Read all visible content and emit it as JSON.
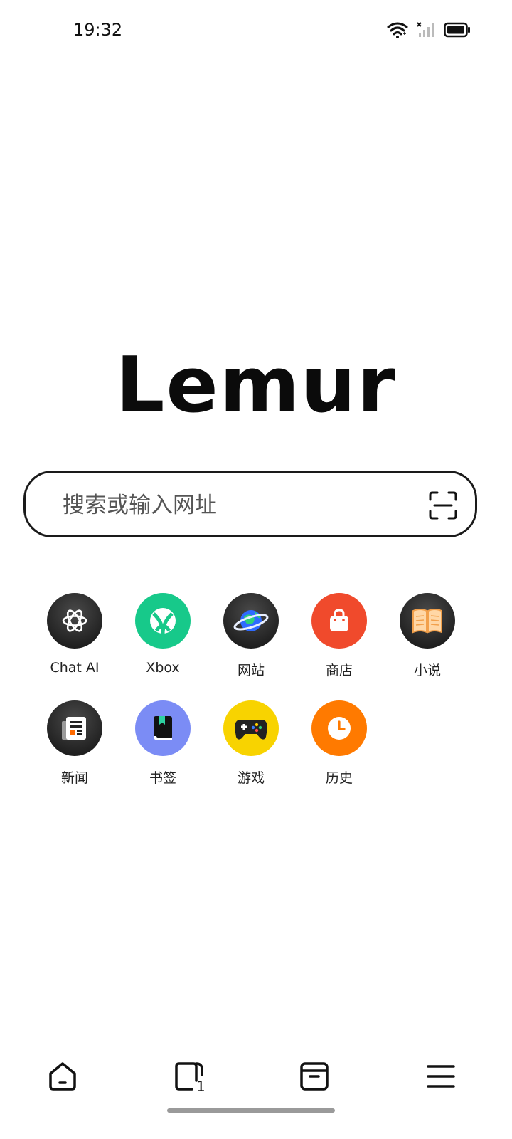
{
  "status_bar": {
    "time": "19:32",
    "icons": [
      "wifi-icon",
      "signal-icon",
      "battery-icon"
    ]
  },
  "logo": {
    "text": "Lemur"
  },
  "search": {
    "placeholder": "搜索或输入网址",
    "scan_icon": "scan-icon"
  },
  "shortcuts": [
    {
      "label": "Chat AI",
      "icon": "chatgpt-icon",
      "color": "#222222"
    },
    {
      "label": "Xbox",
      "icon": "xbox-icon",
      "color": "#17C98A"
    },
    {
      "label": "网站",
      "icon": "planet-icon",
      "color": "#222222"
    },
    {
      "label": "商店",
      "icon": "shopping-bag-icon",
      "color": "#F04A2C"
    },
    {
      "label": "小说",
      "icon": "open-book-icon",
      "color": "#222222"
    },
    {
      "label": "新闻",
      "icon": "newspaper-icon",
      "color": "#222222"
    },
    {
      "label": "书签",
      "icon": "bookmark-book-icon",
      "color": "#7B8CF5"
    },
    {
      "label": "游戏",
      "icon": "gamepad-icon",
      "color": "#F8D300"
    },
    {
      "label": "历史",
      "icon": "clock-icon",
      "color": "#FF7A00"
    }
  ],
  "bottom_nav": {
    "home_icon": "home-icon",
    "tabs_icon": "tabs-icon",
    "tabs_count": "1",
    "archive_icon": "archive-icon",
    "menu_icon": "menu-icon"
  }
}
